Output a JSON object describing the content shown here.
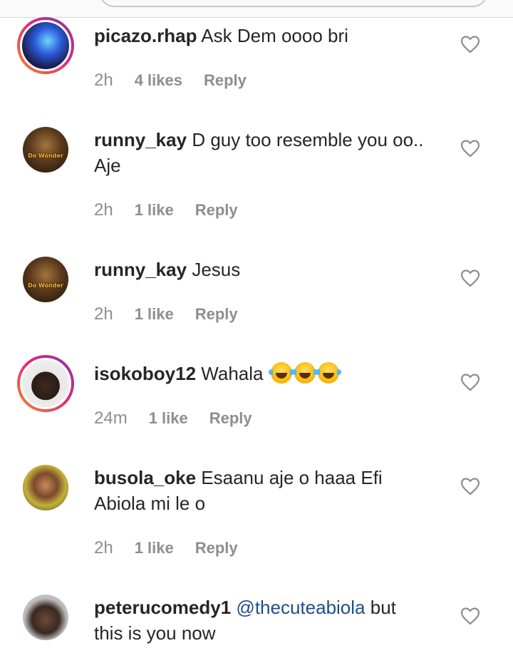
{
  "header": {
    "search_bar": ""
  },
  "comments": [
    {
      "username": "picazo.rhap",
      "text_line1": "Ask Dem oooo bri",
      "text_line2": "",
      "time": "2h",
      "likes": "4 likes",
      "reply": "Reply",
      "avatar_style": "story"
    },
    {
      "username": "runny_kay",
      "text_line1": "D guy too resemble you oo..",
      "text_line2": "Aje",
      "time": "2h",
      "likes": "1 like",
      "reply": "Reply",
      "avatar_style": "plain",
      "avatar_text": "Do Wonder"
    },
    {
      "username": "runny_kay",
      "text_line1": "Jesus",
      "text_line2": "",
      "time": "2h",
      "likes": "1 like",
      "reply": "Reply",
      "avatar_style": "plain",
      "avatar_text": "Do Wonder"
    },
    {
      "username": "isokoboy12",
      "text_line1": "Wahala",
      "emoji": "😂😂😂",
      "emoji_name": "tears-of-joy",
      "time": "24m",
      "likes": "1 like",
      "reply": "Reply",
      "avatar_style": "story"
    },
    {
      "username": "busola_oke",
      "text_line1": "Esaanu aje o haaa Efi",
      "text_line2": "Abiola mi le o",
      "time": "2h",
      "likes": "1 like",
      "reply": "Reply",
      "avatar_style": "plain"
    },
    {
      "username": "peterucomedy1",
      "mention": "@thecuteabiola",
      "text_line1_after": "but",
      "text_line2": "this is you now",
      "avatar_style": "plain"
    }
  ],
  "icons": {
    "like": "heart-outline-icon"
  },
  "colors": {
    "text": "#262626",
    "secondary": "#8e8e8e",
    "mention": "#1d4f8c",
    "story_ring_start": "#f58529",
    "story_ring_end": "#8134af"
  }
}
